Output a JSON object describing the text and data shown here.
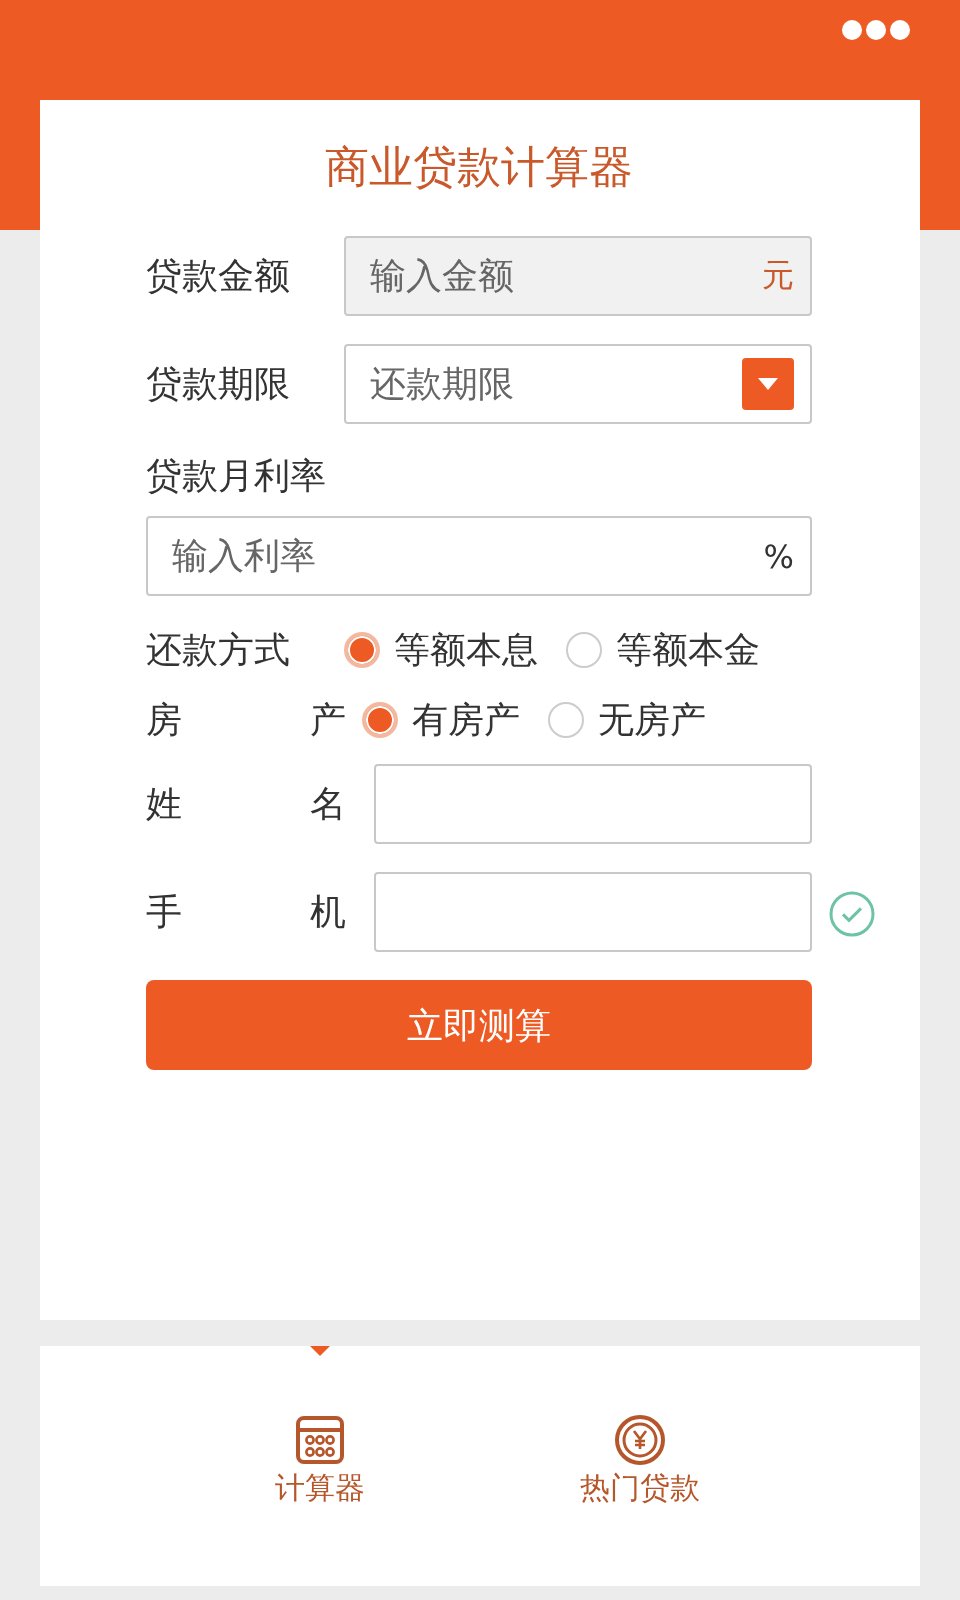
{
  "title": "商业贷款计算器",
  "fields": [
    {
      "kind": "input",
      "label": "贷款金额",
      "placeholder": "输入金额",
      "unit": "元",
      "disabled": true
    },
    {
      "kind": "select",
      "label": "贷款期限",
      "placeholder": "还款期限"
    },
    {
      "kind": "stacked",
      "label": "贷款月利率",
      "placeholder": "输入利率",
      "unit": "%",
      "disabled": false
    },
    {
      "kind": "radio",
      "label": "还款方式",
      "options": [
        {
          "label": "等额本息",
          "selected": true
        },
        {
          "label": "等额本金",
          "selected": false
        }
      ]
    },
    {
      "kind": "radio",
      "label_parts": [
        "房",
        "产"
      ],
      "options": [
        {
          "label": "有房产",
          "selected": true
        },
        {
          "label": "无房产",
          "selected": false
        }
      ]
    },
    {
      "kind": "input",
      "label_parts": [
        "姓",
        "名"
      ],
      "disabled": false,
      "valid": false
    },
    {
      "kind": "input",
      "label_parts": [
        "手",
        "机"
      ],
      "disabled": false,
      "valid": true
    }
  ],
  "submit": "立即测算",
  "tabs": [
    {
      "kind": "calculator",
      "label": "计算器",
      "selected": true
    },
    {
      "kind": "coin",
      "label": "热门贷款",
      "selected": false
    }
  ]
}
